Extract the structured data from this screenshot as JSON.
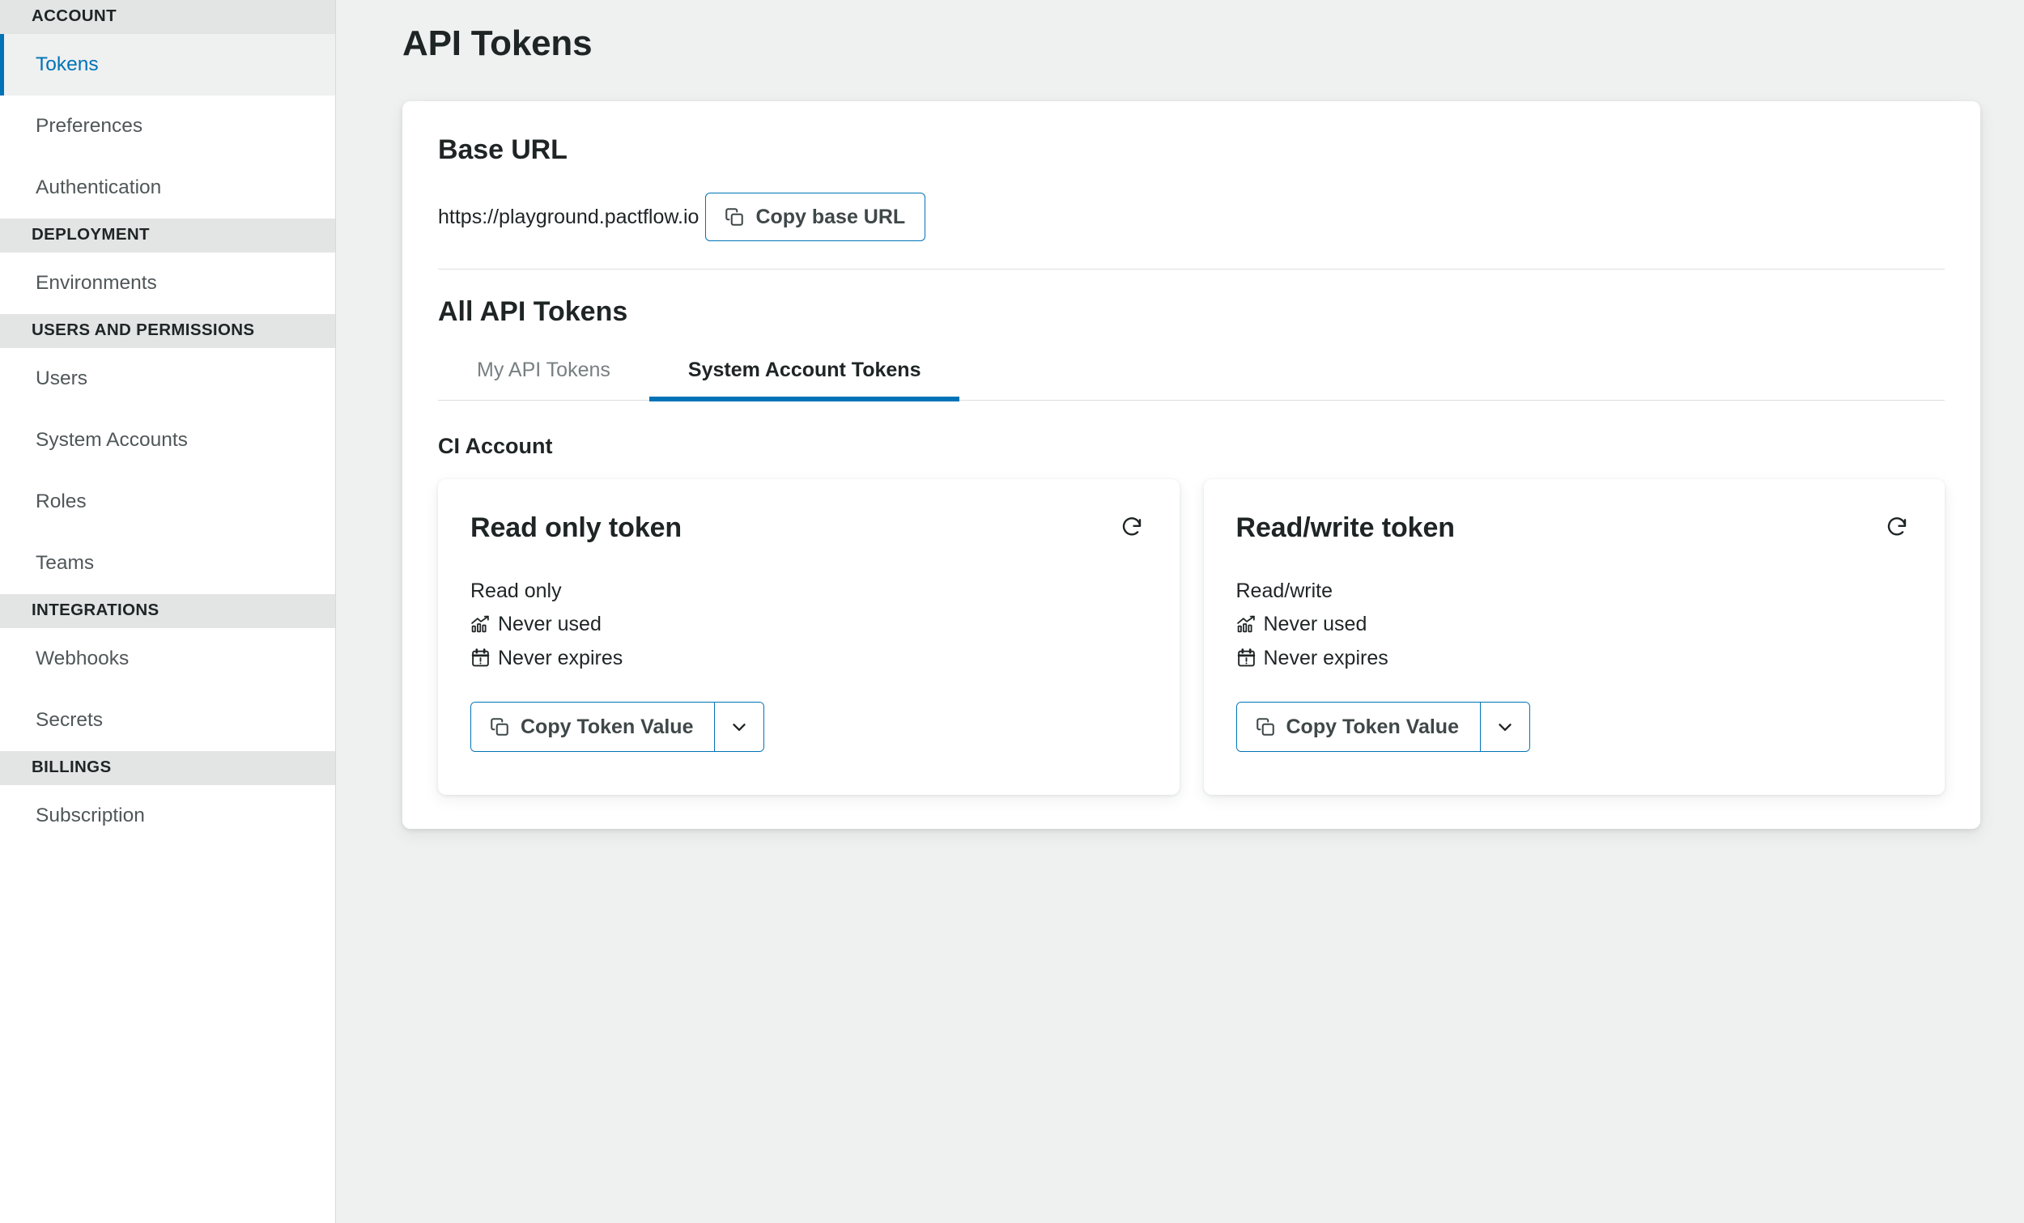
{
  "sidebar": {
    "sections": [
      {
        "header": "ACCOUNT",
        "items": [
          {
            "label": "Tokens",
            "active": true
          },
          {
            "label": "Preferences",
            "active": false
          },
          {
            "label": "Authentication",
            "active": false
          }
        ]
      },
      {
        "header": "DEPLOYMENT",
        "items": [
          {
            "label": "Environments",
            "active": false
          }
        ]
      },
      {
        "header": "USERS AND PERMISSIONS",
        "items": [
          {
            "label": "Users",
            "active": false
          },
          {
            "label": "System Accounts",
            "active": false
          },
          {
            "label": "Roles",
            "active": false
          },
          {
            "label": "Teams",
            "active": false
          }
        ]
      },
      {
        "header": "INTEGRATIONS",
        "items": [
          {
            "label": "Webhooks",
            "active": false
          },
          {
            "label": "Secrets",
            "active": false
          }
        ]
      },
      {
        "header": "BILLINGS",
        "items": [
          {
            "label": "Subscription",
            "active": false
          }
        ]
      }
    ]
  },
  "page": {
    "title": "API Tokens"
  },
  "base_url": {
    "heading": "Base URL",
    "value": "https://playground.pactflow.io",
    "copy_label": "Copy base URL",
    "copy_icon": "copy-icon"
  },
  "all_tokens": {
    "heading": "All API Tokens",
    "tabs": [
      {
        "label": "My API Tokens",
        "active": false
      },
      {
        "label": "System Account Tokens",
        "active": true
      }
    ],
    "account_name": "CI Account",
    "cards": [
      {
        "title": "Read only token",
        "permission": "Read only",
        "usage": "Never used",
        "usage_icon": "analytics-chart-icon",
        "expiry": "Never expires",
        "expiry_icon": "calendar-alert-icon",
        "regenerate_icon": "refresh-icon",
        "copy_label": "Copy Token Value",
        "copy_icon": "copy-icon",
        "dropdown_icon": "chevron-down-icon"
      },
      {
        "title": "Read/write token",
        "permission": "Read/write",
        "usage": "Never used",
        "usage_icon": "analytics-chart-icon",
        "expiry": "Never expires",
        "expiry_icon": "calendar-alert-icon",
        "regenerate_icon": "refresh-icon",
        "copy_label": "Copy Token Value",
        "copy_icon": "copy-icon",
        "dropdown_icon": "chevron-down-icon"
      }
    ]
  },
  "colors": {
    "accent": "#0073b6",
    "page_background": "#eff0f0",
    "section_header_background": "#e3e5e5",
    "text": "#1f2425",
    "muted_text": "#777f82"
  }
}
